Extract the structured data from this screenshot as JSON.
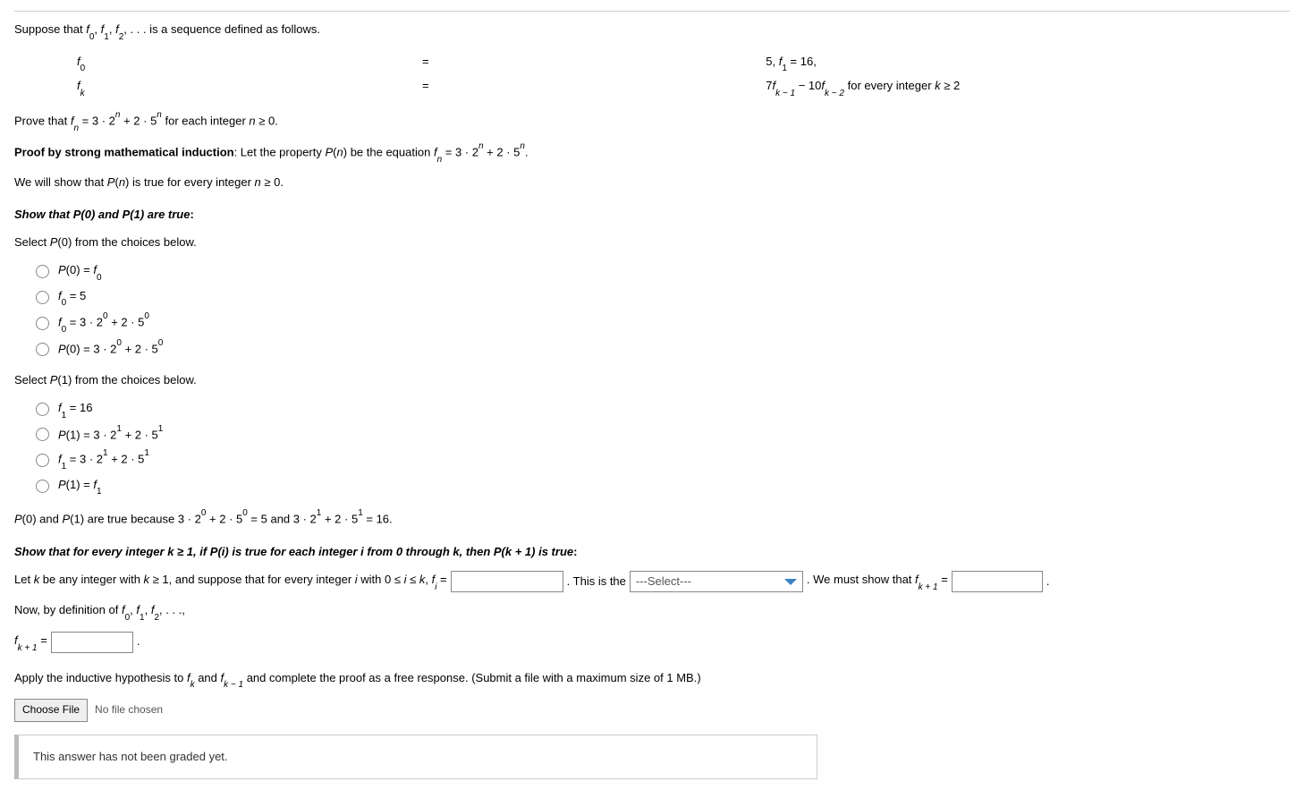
{
  "intro": {
    "line1_a": "Suppose that ",
    "line1_b": " is a sequence defined as follows."
  },
  "eq": {
    "r1c1_a": "f",
    "r1c1_sub": "0",
    "r1c2": "=",
    "r1c3": "5, f₁ = 16,",
    "r1c3_a": "5, ",
    "r1c3_b": "f",
    "r1c3_bsub": "1",
    "r1c3_c": " = 16,",
    "r2c1_a": "f",
    "r2c1_sub": "k",
    "r2c2": "=",
    "r2c3_a": "7",
    "r2c3_b": "f",
    "r2c3_bsub": "k − 1",
    "r2c3_c": " − 10",
    "r2c3_d": "f",
    "r2c3_dsub": "k − 2",
    "r2c3_e": " for every integer ",
    "r2c3_f": "k",
    "r2c3_g": " ≥ 2"
  },
  "prove": {
    "a": "Prove that ",
    "f": "f",
    "fsub": "n",
    "b": " = ",
    "c": "3 · 2",
    "csup": "n",
    "d": " + 2 · 5",
    "dsup": "n",
    "e": " for each integer ",
    "n": "n",
    "g": " ≥ 0."
  },
  "proof_label": {
    "a": "Proof by strong mathematical induction",
    "b": ": Let the property ",
    "p": "P",
    "paren": "(",
    "n": "n",
    "paren2": ")",
    "c": " be the equation ",
    "f": "f",
    "fsub": "n",
    "d": " = 3 · 2",
    "dsup": "n",
    "e": " + 2 · 5",
    "esup": "n",
    "f2": "."
  },
  "show_all": {
    "a": "We will show that ",
    "p": "P",
    "b": "(",
    "n": "n",
    "c": ") is true for every integer ",
    "n2": "n",
    "d": " ≥ 0."
  },
  "basis_heading": "Show that P(0) and P(1) are true",
  "basis_heading_colon": ":",
  "select_p0": "Select P(0) from the choices below.",
  "p0_choices": {
    "c1_a": "P",
    "c1_b": "(0) = ",
    "c1_f": "f",
    "c1_fsub": "0",
    "c2_f": "f",
    "c2_fsub": "0",
    "c2_b": " = 5",
    "c3_f": "f",
    "c3_fsub": "0",
    "c3_b": " = 3 · 2",
    "c3_sup1": "0",
    "c3_c": " + 2 · 5",
    "c3_sup2": "0",
    "c4_a": "P",
    "c4_b": "(0) = 3 · 2",
    "c4_sup1": "0",
    "c4_c": " + 2 · 5",
    "c4_sup2": "0"
  },
  "select_p1": "Select P(1) from the choices below.",
  "p1_choices": {
    "c1_f": "f",
    "c1_fsub": "1",
    "c1_b": " = 16",
    "c2_a": "P",
    "c2_b": "(1) = 3 · 2",
    "c2_sup1": "1",
    "c2_c": " + 2 · 5",
    "c2_sup2": "1",
    "c3_f": "f",
    "c3_fsub": "1",
    "c3_b": " = 3 · 2",
    "c3_sup1": "1",
    "c3_c": " + 2 · 5",
    "c3_sup2": "1",
    "c4_a": "P",
    "c4_b": "(1) = ",
    "c4_f": "f",
    "c4_fsub": "1"
  },
  "basis_justify": {
    "a": "P",
    "b": "(0) and ",
    "c": "P",
    "d": "(1) are true because 3 · 2",
    "sup1": "0",
    "e": " + 2 · 5",
    "sup2": "0",
    "f": " = 5 and 3 · 2",
    "sup3": "1",
    "g": " + 2 · 5",
    "sup4": "1",
    "h": " = 16."
  },
  "inductive_heading": {
    "a": "Show that for every integer k ≥ 1, if P(i) is true for each integer i from 0 through k, then P(k + 1) is true",
    "colon": ":"
  },
  "ih_row": {
    "a": "Let ",
    "k": "k",
    "b": " be any integer with ",
    "k2": "k",
    "c": " ≥ 1, and suppose that for every integer ",
    "i": "i",
    "d": " with 0 ≤ ",
    "i2": "i",
    "e": " ≤ ",
    "k3": "k",
    "f": ", ",
    "fi": "f",
    "fisub": "i",
    "g": " = ",
    "h": ". This is the ",
    "select_placeholder": "---Select---",
    "j": ". We must show that ",
    "fk1": "f",
    "fk1sub": "k + 1",
    "k4": " = ",
    "end": "."
  },
  "now_def": {
    "a": "Now, by definition of ",
    "f0": "f",
    "f0sub": "0",
    "c1": ", ",
    "f1": "f",
    "f1sub": "1",
    "c2": ", ",
    "f2": "f",
    "f2sub": "2",
    "c3": ", . . .,"
  },
  "fk1_line": {
    "f": "f",
    "fsub": "k + 1",
    "eq": " = ",
    "end": "."
  },
  "apply_ih": {
    "a": "Apply the inductive hypothesis to ",
    "fk": "f",
    "fksub": "k",
    "b": " and ",
    "fk1": "f",
    "fk1sub": "k − 1",
    "c": " and complete the proof as a free response. (Submit a file with a maximum size of 1 MB.)"
  },
  "file": {
    "button": "Choose File",
    "status": "No file chosen"
  },
  "grade_note": "This answer has not been graded yet."
}
